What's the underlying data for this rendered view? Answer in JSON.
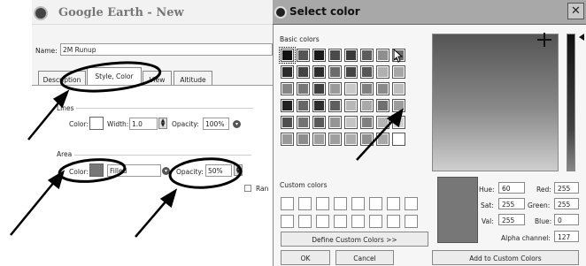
{
  "ge": {
    "title": "Google Earth - New",
    "name_label": "Name:",
    "name_value": "2M Runup",
    "tabs": [
      "Description",
      "Style, Color",
      "View",
      "Altitude"
    ],
    "lines_label": "Lines",
    "color_label": "Color:",
    "width_label": "Width:",
    "width_value": "1.0",
    "opacity_label": "Opacity:",
    "lines_opacity": "100%",
    "area_label": "Area",
    "area_fill": "Filled",
    "area_opacity": "50%",
    "random_label": "Ran"
  },
  "dialog": {
    "title": "Select color",
    "basic_label": "Basic colors",
    "custom_label": "Custom colors",
    "define_btn": "Define Custom Colors >>",
    "ok_btn": "OK",
    "cancel_btn": "Cancel",
    "add_btn": "Add to Custom Colors",
    "hue_label": "Hue:",
    "hue": "60",
    "sat_label": "Sat:",
    "sat": "255",
    "val_label": "Val:",
    "val": "255",
    "red_label": "Red:",
    "red": "255",
    "green_label": "Green:",
    "green": "255",
    "blue_label": "Blue:",
    "blue": "0",
    "alpha_label": "Alpha channel:",
    "alpha": "127",
    "basic_colors": [
      "#111111",
      "#555555",
      "#1a1a1a",
      "#4a4a4a",
      "#3a3a3a",
      "#5c5c5c",
      "#8f8f8f",
      "#6a6a6a",
      "#2a2a2a",
      "#444444",
      "#2c2c2c",
      "#6b6b6b",
      "#454545",
      "#575757",
      "#b0b0b0",
      "#a5a5a5",
      "#858585",
      "#777777",
      "#3f3f3f",
      "#9a9a9a",
      "#c9c9c9",
      "#7f7f7f",
      "#8a8a8a",
      "#bdbdbd",
      "#222222",
      "#666666",
      "#2e2e2e",
      "#5f5f5f",
      "#b8b8b8",
      "#a9a9a9",
      "#707070",
      "#9c9c9c",
      "#505050",
      "#737373",
      "#5a5a5a",
      "#959595",
      "#c4c4c4",
      "#808080",
      "#b5b5b5",
      "#d2d2d2",
      "#999999",
      "#8c8c8c",
      "#a0a0a0",
      "#9e9e9e",
      "#adadad",
      "#909090",
      "#a8a8a8",
      "#ffffff"
    ],
    "preview_color": "#777777"
  }
}
